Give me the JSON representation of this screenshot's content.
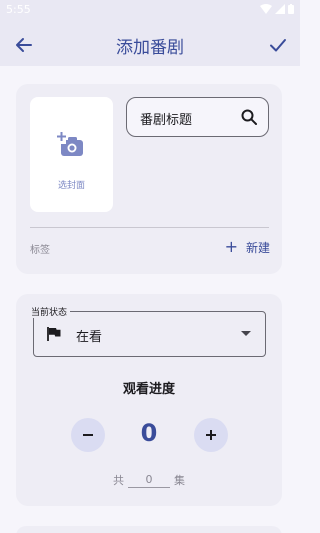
{
  "status_bar": {
    "time": "5:55"
  },
  "app_bar": {
    "title": "添加番剧"
  },
  "cover": {
    "label": "选封面"
  },
  "search": {
    "text": "番剧标题"
  },
  "tags": {
    "label": "标签",
    "new_label": "新建"
  },
  "status_select": {
    "label": "当前状态",
    "value": "在看"
  },
  "progress": {
    "title": "观看进度",
    "count": "0",
    "total_prefix": "共",
    "total_value": "0",
    "total_suffix": "集"
  },
  "colors": {
    "accent": "#3a4c9a",
    "background": "#f6f5fb",
    "card": "#eeedf5",
    "button_tint": "#dadcf2"
  }
}
